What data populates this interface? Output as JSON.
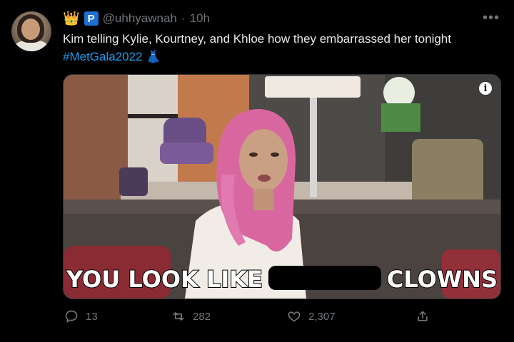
{
  "tweet": {
    "badges": [
      "👑",
      "P"
    ],
    "handle": "@uhhyawnah",
    "separator": "·",
    "time": "10h",
    "text": "Kim telling Kylie, Kourtney, and Khloe how they embarrassed her tonight",
    "hashtag": "#MetGala2022",
    "emoji": "👗",
    "more": "•••"
  },
  "media": {
    "caption_before": "YOU LOOK LIKE",
    "caption_after": "CLOWNS",
    "info_icon": "i"
  },
  "actions": {
    "replies": "13",
    "retweets": "282",
    "likes": "2,307"
  },
  "colors": {
    "background": "#000000",
    "text": "#e7e9ea",
    "muted": "#71767b",
    "link": "#1d9bf0",
    "badge": "#1d6fd1"
  }
}
